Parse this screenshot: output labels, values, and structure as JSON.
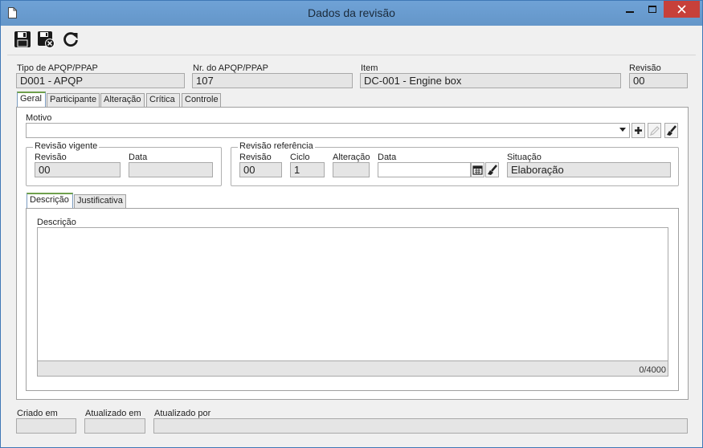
{
  "window": {
    "title": "Dados da revisão"
  },
  "toolbar": {
    "save": "save-icon",
    "save_close": "save-close-icon",
    "refresh": "refresh-icon"
  },
  "header": {
    "type_label": "Tipo de APQP/PPAP",
    "type_value": "D001 - APQP",
    "number_label": "Nr. do APQP/PPAP",
    "number_value": "107",
    "item_label": "Item",
    "item_value": "DC-001 - Engine box",
    "revision_label": "Revisão",
    "revision_value": "00"
  },
  "tabs": [
    "Geral",
    "Participante",
    "Alteração",
    "Crítica",
    "Controle"
  ],
  "general": {
    "motivo_label": "Motivo",
    "motivo_value": "",
    "current": {
      "title": "Revisão vigente",
      "rev_label": "Revisão",
      "rev_value": "00",
      "date_label": "Data",
      "date_value": ""
    },
    "reference": {
      "title": "Revisão referência",
      "rev_label": "Revisão",
      "rev_value": "00",
      "cycle_label": "Ciclo",
      "cycle_value": "1",
      "change_label": "Alteração",
      "change_value": "",
      "date_label": "Data",
      "date_value": "",
      "status_label": "Situação",
      "status_value": "Elaboração"
    },
    "subtabs": [
      "Descrição",
      "Justificativa"
    ],
    "description_label": "Descrição",
    "description_value": "",
    "counter": "0/4000"
  },
  "footer": {
    "created_label": "Criado em",
    "created_value": "",
    "updated_label": "Atualizado em",
    "updated_value": "",
    "updated_by_label": "Atualizado por",
    "updated_by_value": ""
  }
}
